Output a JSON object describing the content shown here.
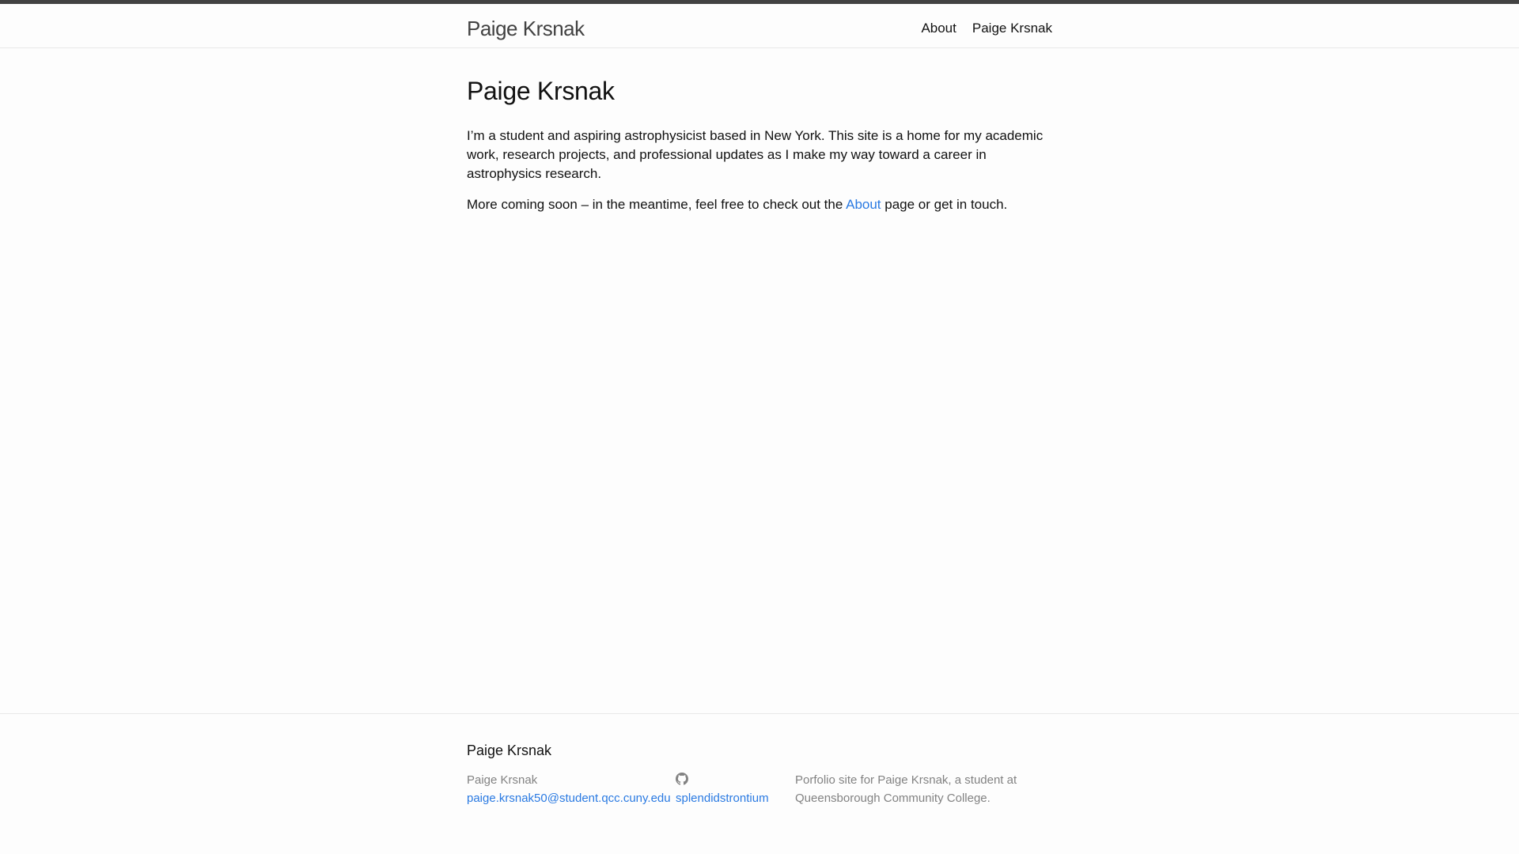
{
  "header": {
    "site_title": "Paige Krsnak",
    "nav": [
      {
        "label": "About"
      },
      {
        "label": "Paige Krsnak"
      }
    ]
  },
  "main": {
    "heading": "Paige Krsnak",
    "paragraph_1": "I’m a student and aspiring astrophysicist based in New York. This site is a home for my academic work, research projects, and professional updates as I make my way toward a career in astrophysics research.",
    "paragraph_2_before": "More coming soon – in the meantime, feel free to check out the ",
    "paragraph_2_link": "About",
    "paragraph_2_after": " page or get in touch."
  },
  "footer": {
    "heading": "Paige Krsnak",
    "name": "Paige Krsnak",
    "email": "paige.krsnak50@student.qcc.cuny.edu",
    "github_icon": "github-icon",
    "github_username": "splendidstrontium",
    "description": "Porfolio site for Paige Krsnak, a student at Queensborough Community College."
  },
  "colors": {
    "link": "#2a7ae2",
    "header_top_border": "#424242",
    "muted_text": "#828282",
    "body_text": "#111111"
  }
}
